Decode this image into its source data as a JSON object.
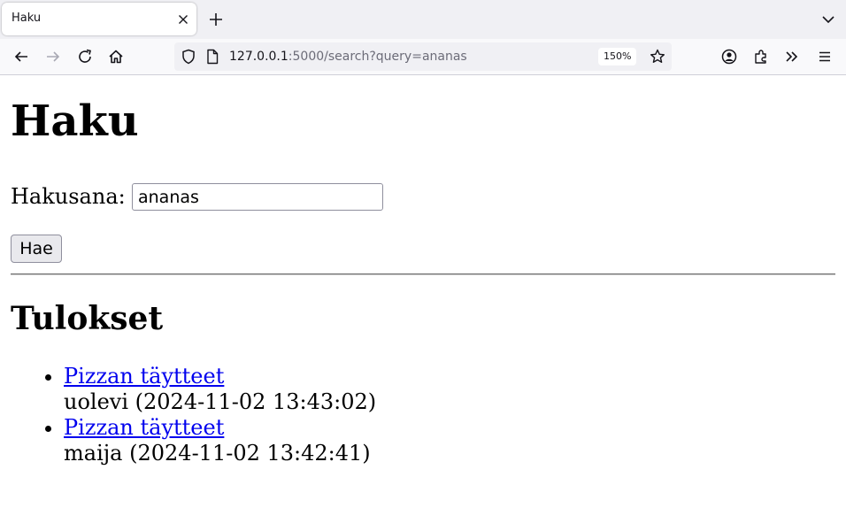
{
  "browser": {
    "tab_title": "Haku",
    "url_host": "127.0.0.1",
    "url_rest": ":5000/search?query=ananas",
    "zoom": "150%"
  },
  "page": {
    "heading": "Haku",
    "search_label": "Hakusana:",
    "search_value": "ananas",
    "search_button": "Hae",
    "results_heading": "Tulokset",
    "results": [
      {
        "title": "Pizzan täytteet",
        "meta": "uolevi (2024-11-02 13:43:02)"
      },
      {
        "title": "Pizzan täytteet",
        "meta": "maija (2024-11-02 13:42:41)"
      }
    ]
  },
  "colors": {
    "link": "#0000ee",
    "chrome_bg": "#f0f0f4"
  },
  "icons": [
    "close-icon",
    "plus-icon",
    "chevron-down-icon",
    "back-arrow-icon",
    "forward-arrow-icon",
    "reload-icon",
    "home-icon",
    "shield-icon",
    "page-icon",
    "star-icon",
    "account-icon",
    "extensions-icon",
    "overflow-chevrons-icon",
    "hamburger-menu-icon"
  ]
}
